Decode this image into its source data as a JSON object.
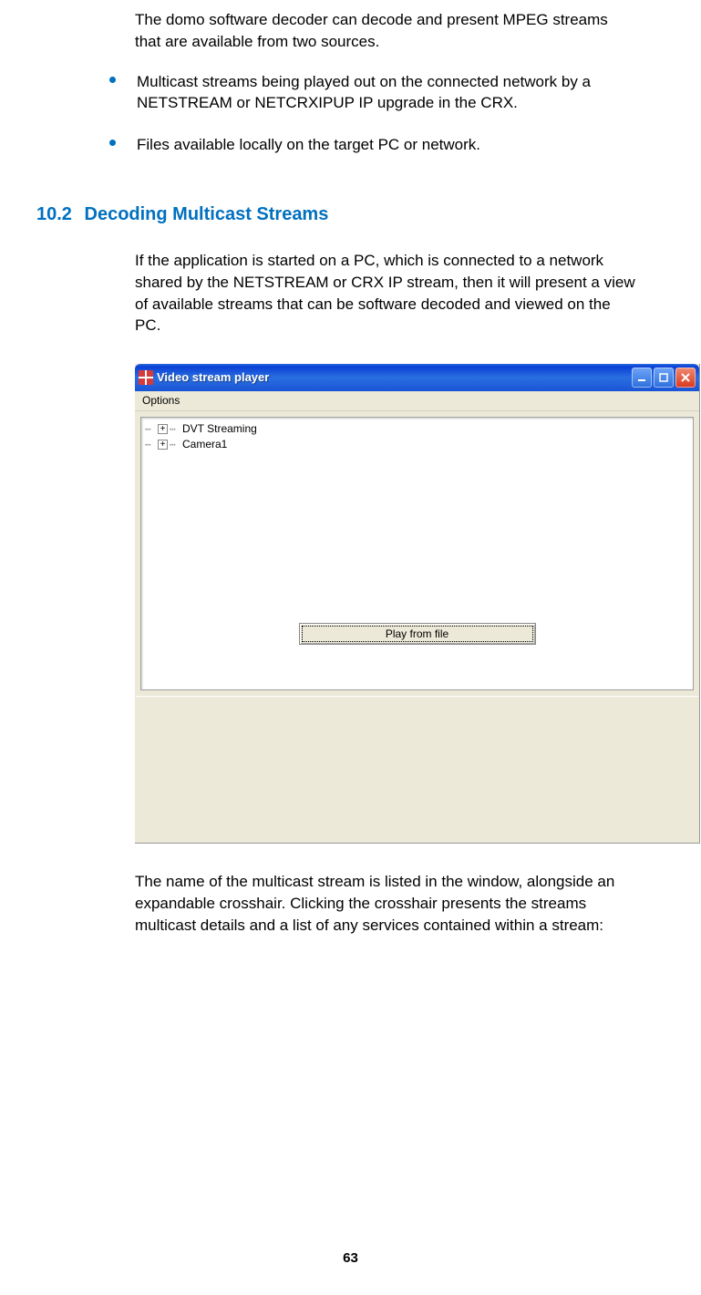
{
  "intro_para": "The domo software decoder can decode and present MPEG streams that are available from two sources.",
  "bullets": [
    "Multicast streams being played out on the connected network by a NETSTREAM or NETCRXIPUP IP upgrade in the CRX.",
    "Files available locally on the target PC or network."
  ],
  "section": {
    "number": "10.2",
    "title": "Decoding Multicast Streams"
  },
  "section_para_1": "If the application is started on a PC, which is connected to a network shared by the NETSTREAM or CRX IP stream, then it will present a view of available streams that can be software decoded and viewed on the PC.",
  "window": {
    "title": "Video stream player",
    "menu_options": "Options",
    "tree_items": [
      "DVT Streaming",
      "Camera1"
    ],
    "play_button": "Play from file"
  },
  "section_para_2": "The name of the multicast stream is listed in the window, alongside an expandable crosshair. Clicking the crosshair presents the streams multicast details and a list of any services contained within a stream:",
  "page_number": "63"
}
